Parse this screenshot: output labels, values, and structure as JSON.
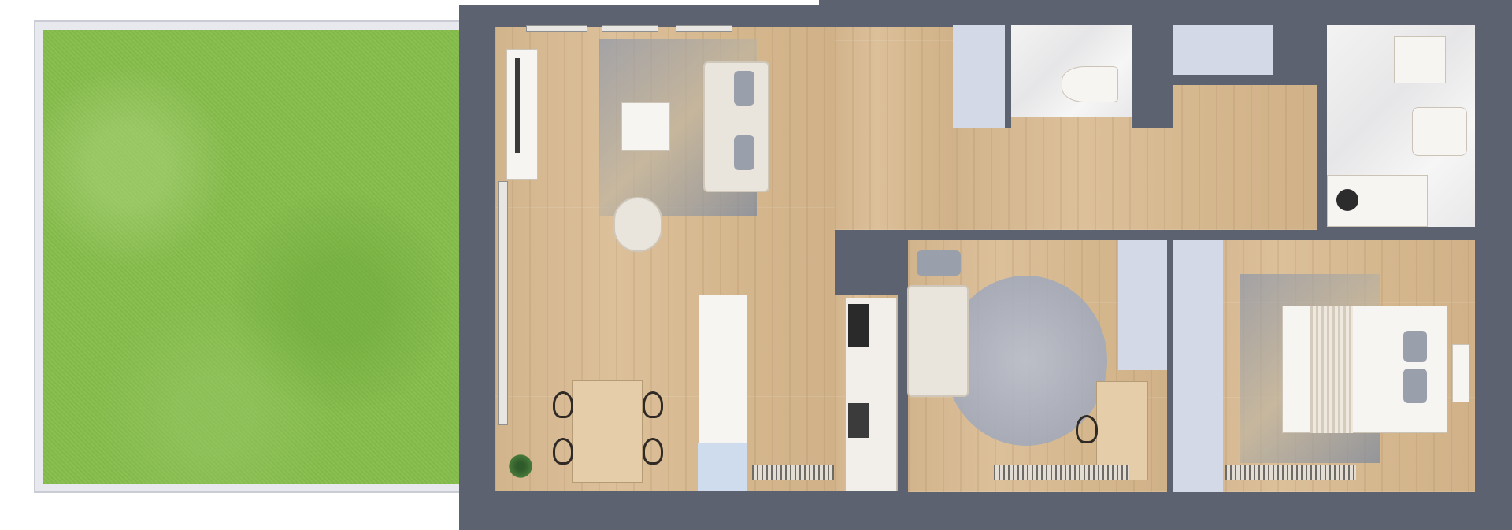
{
  "plan": {
    "wall_color": "#5d6270",
    "floor_color": "#d6b88f",
    "lawn_color": "#86bd4c",
    "closet_color": "#d3d9e6",
    "rooms": [
      "terrace-lawn",
      "living-room",
      "kitchen",
      "hallway",
      "wc",
      "bathroom",
      "bedroom-1",
      "bedroom-2"
    ]
  }
}
